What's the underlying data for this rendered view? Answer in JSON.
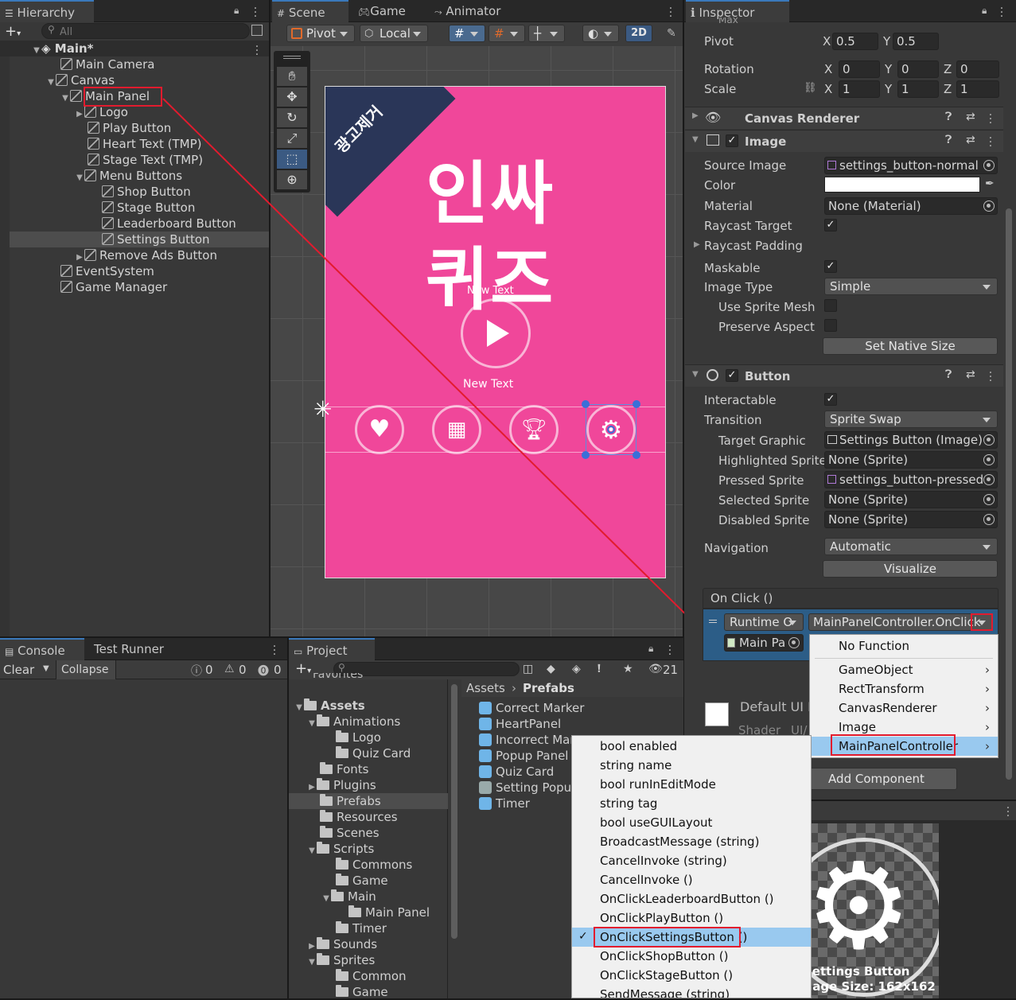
{
  "hierarchy": {
    "tab": "Hierarchy",
    "search_placeholder": "All",
    "scene": "Main*",
    "items": [
      "Main Camera",
      "Canvas",
      "Main Panel",
      "Logo",
      "Play Button",
      "Heart Text (TMP)",
      "Stage Text (TMP)",
      "Menu Buttons",
      "Shop Button",
      "Stage Button",
      "Leaderboard Button",
      "Settings Button",
      "Remove Ads Button",
      "EventSystem",
      "Game Manager"
    ]
  },
  "scene_tabs": {
    "scene": "Scene",
    "game": "Game",
    "animator": "Animator"
  },
  "scene_toolbar": {
    "pivot": "Pivot",
    "local": "Local",
    "mode2d": "2D"
  },
  "game": {
    "corner_label": "광고제거",
    "title_line1": "인싸",
    "title_line2": "퀴즈",
    "new_text_1": "New Text",
    "new_text_2": "New Text",
    "panel_color": "#f0479a"
  },
  "inspector": {
    "tab": "Inspector",
    "max_label": "Max",
    "pivot": {
      "label": "Pivot",
      "x": "0.5",
      "y": "0.5"
    },
    "rotation": {
      "label": "Rotation",
      "x": "0",
      "y": "0",
      "z": "0"
    },
    "scale": {
      "label": "Scale",
      "x": "1",
      "y": "1",
      "z": "1"
    },
    "canvas_renderer": "Canvas Renderer",
    "image": {
      "title": "Image",
      "source_image_label": "Source Image",
      "source_image": "settings_button-normal",
      "color_label": "Color",
      "material_label": "Material",
      "material": "None (Material)",
      "raycast_target": "Raycast Target",
      "raycast_padding": "Raycast Padding",
      "maskable": "Maskable",
      "image_type_label": "Image Type",
      "image_type": "Simple",
      "use_sprite_mesh": "Use Sprite Mesh",
      "preserve_aspect": "Preserve Aspect",
      "set_native_size": "Set Native Size"
    },
    "button": {
      "title": "Button",
      "interactable": "Interactable",
      "transition_label": "Transition",
      "transition": "Sprite Swap",
      "target_graphic_label": "Target Graphic",
      "target_graphic": "Settings Button (Image)",
      "highlighted_label": "Highlighted Sprite",
      "highlighted": "None (Sprite)",
      "pressed_label": "Pressed Sprite",
      "pressed": "settings_button-pressed",
      "selected_label": "Selected Sprite",
      "selected": "None (Sprite)",
      "disabled_label": "Disabled Sprite",
      "disabled": "None (Sprite)",
      "navigation_label": "Navigation",
      "navigation": "Automatic",
      "visualize": "Visualize"
    },
    "onclick": {
      "header": "On Click ()",
      "runtime": "Runtime O",
      "function": "MainPanelController.OnClick",
      "object": "Main Pa"
    },
    "default_material": "Default UI M",
    "shader_label": "Shader",
    "shader_value": "UI/",
    "add_component": "Add Component",
    "preview_name": "Settings Button",
    "preview_size": "Image Size: 162x162"
  },
  "function_menu": {
    "no_function": "No Function",
    "items": [
      "GameObject",
      "RectTransform",
      "CanvasRenderer",
      "Image",
      "MainPanelController"
    ]
  },
  "method_menu": {
    "items": [
      "bool enabled",
      "string name",
      "bool runInEditMode",
      "string tag",
      "bool useGUILayout",
      "BroadcastMessage (string)",
      "CancelInvoke (string)",
      "CancelInvoke ()",
      "OnClickLeaderboardButton ()",
      "OnClickPlayButton ()",
      "OnClickSettingsButton ()",
      "OnClickShopButton ()",
      "OnClickStageButton ()",
      "SendMessage (string)"
    ],
    "checked": "OnClickSettingsButton ()"
  },
  "console": {
    "tab": "Console",
    "tab2": "Test Runner",
    "clear": "Clear",
    "collapse": "Collapse",
    "count_log": "0",
    "count_warn": "0",
    "count_err": "0"
  },
  "project": {
    "tab": "Project",
    "count": "21",
    "favorites": "Favorites",
    "assets": "Assets",
    "tree": [
      "Animations",
      "Logo",
      "Quiz Card",
      "Fonts",
      "Plugins",
      "Prefabs",
      "Resources",
      "Scenes",
      "Scripts",
      "Commons",
      "Game",
      "Main",
      "Main Panel",
      "Timer",
      "Sounds",
      "Sprites",
      "Common",
      "Game"
    ],
    "breadcrumb_root": "Assets",
    "breadcrumb_leaf": "Prefabs",
    "prefabs": [
      "Correct Marker",
      "HeartPanel",
      "Incorrect Mar",
      "Popup Panel",
      "Quiz Card",
      "Setting Popup",
      "Timer"
    ]
  }
}
